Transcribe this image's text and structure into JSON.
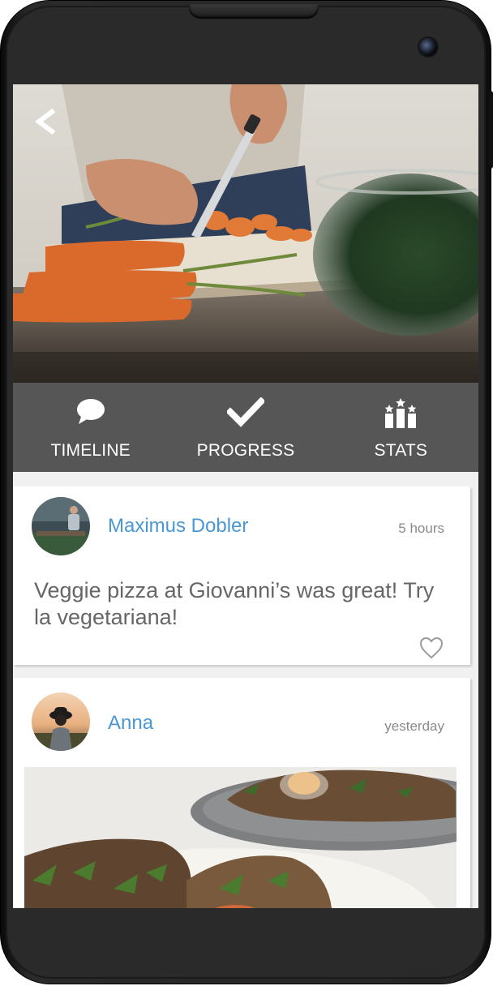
{
  "hero": {
    "back_icon": "chevron-left-icon"
  },
  "tabs": [
    {
      "label": "TIMELINE",
      "icon": "speech-bubble-icon"
    },
    {
      "label": "PROGRESS",
      "icon": "checkmark-icon"
    },
    {
      "label": "STATS",
      "icon": "podium-stars-icon"
    }
  ],
  "feed": {
    "posts": [
      {
        "user": "Maximus Dobler",
        "time": "5 hours",
        "text": "Veggie pizza at Giovanni’s was great! Try la vegetariana!",
        "like_icon": "heart-outline-icon"
      },
      {
        "user": "Anna",
        "time": "yesterday"
      }
    ]
  },
  "colors": {
    "tab_bar": "#565656",
    "username": "#4a98d3",
    "post_text": "#666666",
    "timestamp": "#8a8a8a",
    "feed_bg": "#f1f1f1"
  }
}
